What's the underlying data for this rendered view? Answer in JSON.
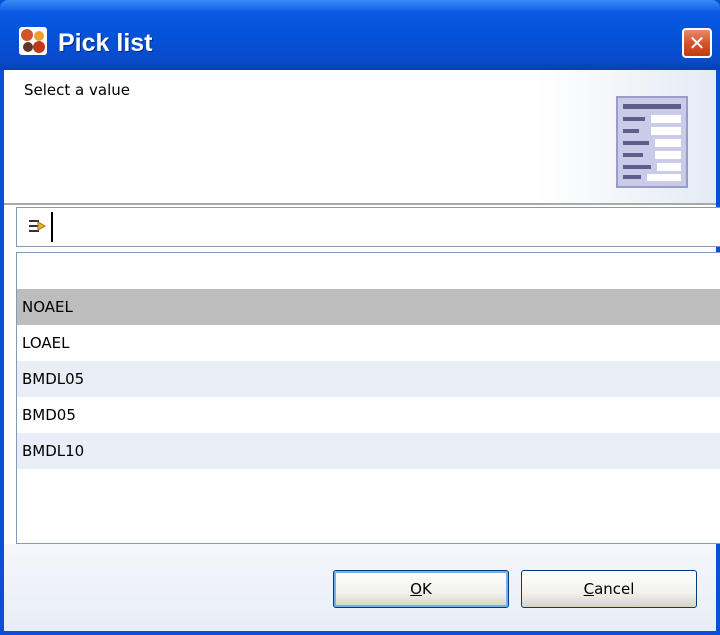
{
  "window": {
    "title": "Pick list",
    "close_label": "✕"
  },
  "header": {
    "message": "Select a value"
  },
  "filter": {
    "value": "",
    "placeholder": ""
  },
  "list": {
    "items": [
      {
        "label": ""
      },
      {
        "label": "NOAEL"
      },
      {
        "label": "LOAEL"
      },
      {
        "label": "BMDL05"
      },
      {
        "label": "BMD05"
      },
      {
        "label": "BMDL10"
      }
    ],
    "selected_index": 1
  },
  "buttons": {
    "ok_mnemonic": "O",
    "ok_rest": "K",
    "cancel_mnemonic": "C",
    "cancel_rest": "ancel"
  },
  "colors": {
    "titlebar": "#0352d9",
    "selection": "#bdbdbd",
    "alt_row": "#eaeef7",
    "close": "#d8532c"
  }
}
